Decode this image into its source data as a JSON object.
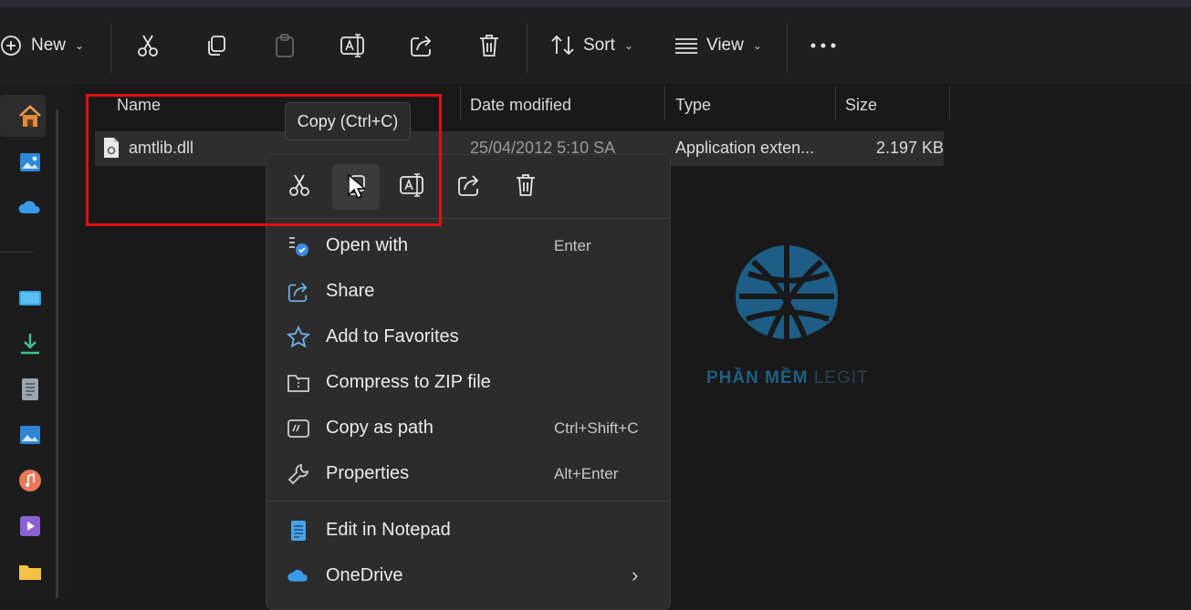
{
  "toolbar": {
    "new_label": "New",
    "sort_label": "Sort",
    "view_label": "View",
    "icons": [
      "plus-circle-icon",
      "cut-icon",
      "copy-icon",
      "paste-icon",
      "rename-icon",
      "share-icon",
      "delete-icon",
      "sort-icon",
      "view-icon",
      "more-icon"
    ]
  },
  "columns": {
    "name": "Name",
    "date": "Date modified",
    "type": "Type",
    "size": "Size"
  },
  "file": {
    "name": "amtlib.dll",
    "date": "25/04/2012 5:10 SA",
    "type": "Application exten...",
    "size": "2.197 KB"
  },
  "tooltip": "Copy (Ctrl+C)",
  "menu": {
    "items": [
      {
        "label": "Open with",
        "shortcut": "Enter",
        "icon": "open-with-icon"
      },
      {
        "label": "Share",
        "shortcut": "",
        "icon": "share-icon"
      },
      {
        "label": "Add to Favorites",
        "shortcut": "",
        "icon": "star-icon"
      },
      {
        "label": "Compress to ZIP file",
        "shortcut": "",
        "icon": "zip-folder-icon"
      },
      {
        "label": "Copy as path",
        "shortcut": "Ctrl+Shift+C",
        "icon": "copy-path-icon"
      },
      {
        "label": "Properties",
        "shortcut": "Alt+Enter",
        "icon": "wrench-icon"
      },
      {
        "label": "Edit in Notepad",
        "shortcut": "",
        "icon": "notepad-icon"
      },
      {
        "label": "OneDrive",
        "shortcut": "",
        "icon": "onedrive-icon"
      }
    ]
  },
  "watermark": {
    "brand": "PHẦN MỀM",
    "suffix": "LEGIT"
  },
  "colors": {
    "highlight_box": "#e01010",
    "accent": "#3a8ee6"
  }
}
